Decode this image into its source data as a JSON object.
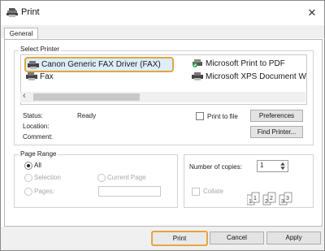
{
  "window": {
    "title": "Print",
    "close_glyph": "✕"
  },
  "tabs": [
    {
      "label": "General"
    }
  ],
  "select_printer": {
    "label": "Select Printer",
    "printers": [
      {
        "name": "Canon Generic FAX Driver (FAX)",
        "icon": "fax-printer-icon",
        "selected": true
      },
      {
        "name": "Fax",
        "icon": "fax-printer-icon"
      },
      {
        "name": "Microsoft Print to PDF",
        "icon": "default-printer-icon"
      },
      {
        "name": "Microsoft XPS Document W",
        "icon": "printer-icon"
      }
    ],
    "scroll_left": "‹",
    "status_label": "Status:",
    "status_value": "Ready",
    "location_label": "Location:",
    "comment_label": "Comment:",
    "print_to_file_label": "Print to file",
    "preferences_label": "Preferences",
    "find_printer_label": "Find Printer..."
  },
  "page_range": {
    "label": "Page Range",
    "all_label": "All",
    "selection_label": "Selection",
    "current_page_label": "Current Page",
    "pages_label": "Pages:"
  },
  "copies": {
    "number_label": "Number of copies:",
    "value": "1",
    "collate_label": "Collate",
    "collate_icons": [
      "1",
      "1",
      "2",
      "2",
      "3",
      "3"
    ]
  },
  "footer": {
    "print_label": "Print",
    "cancel_label": "Cancel",
    "apply_label": "Apply"
  },
  "colors": {
    "focus": "#e5a540",
    "selection": "#ddeeff"
  }
}
